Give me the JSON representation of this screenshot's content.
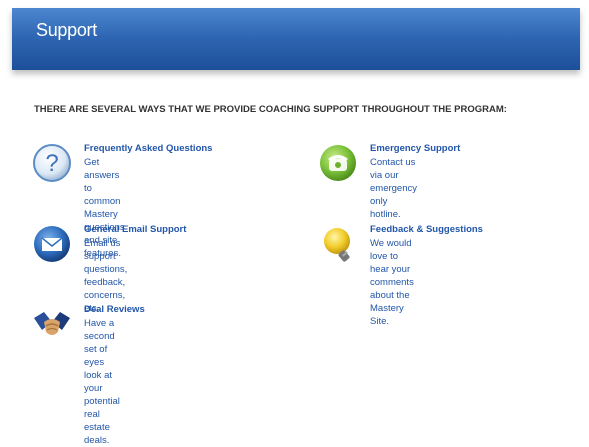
{
  "header": {
    "title": "Support"
  },
  "intro": "THERE ARE SEVERAL WAYS THAT WE PROVIDE COACHING SUPPORT THROUGHOUT THE PROGRAM:",
  "items": [
    {
      "name": "Frequently Asked Questions",
      "desc_lines": [
        "Get answers to common Mastery",
        "questions and site features."
      ],
      "icon": "question-icon"
    },
    {
      "name": "Emergency Support",
      "desc_lines": [
        "Contact us via our emergency only",
        "hotline."
      ],
      "icon": "telephone-icon"
    },
    {
      "name": "General Email Support",
      "desc_lines": [
        "Email us support questions,",
        "feedback, concerns, etc."
      ],
      "icon": "envelope-icon"
    },
    {
      "name": "Feedback & Suggestions",
      "desc_lines": [
        "We would love to hear your",
        "comments about the Mastery Site."
      ],
      "icon": "lightbulb-icon"
    },
    {
      "name": "Deal Reviews",
      "desc_lines": [
        "Have a second set of eyes look at",
        "your potential real estate deals."
      ],
      "icon": "handshake-icon"
    }
  ],
  "colors": {
    "header": "#2f67b4",
    "link": "#2256a8"
  }
}
